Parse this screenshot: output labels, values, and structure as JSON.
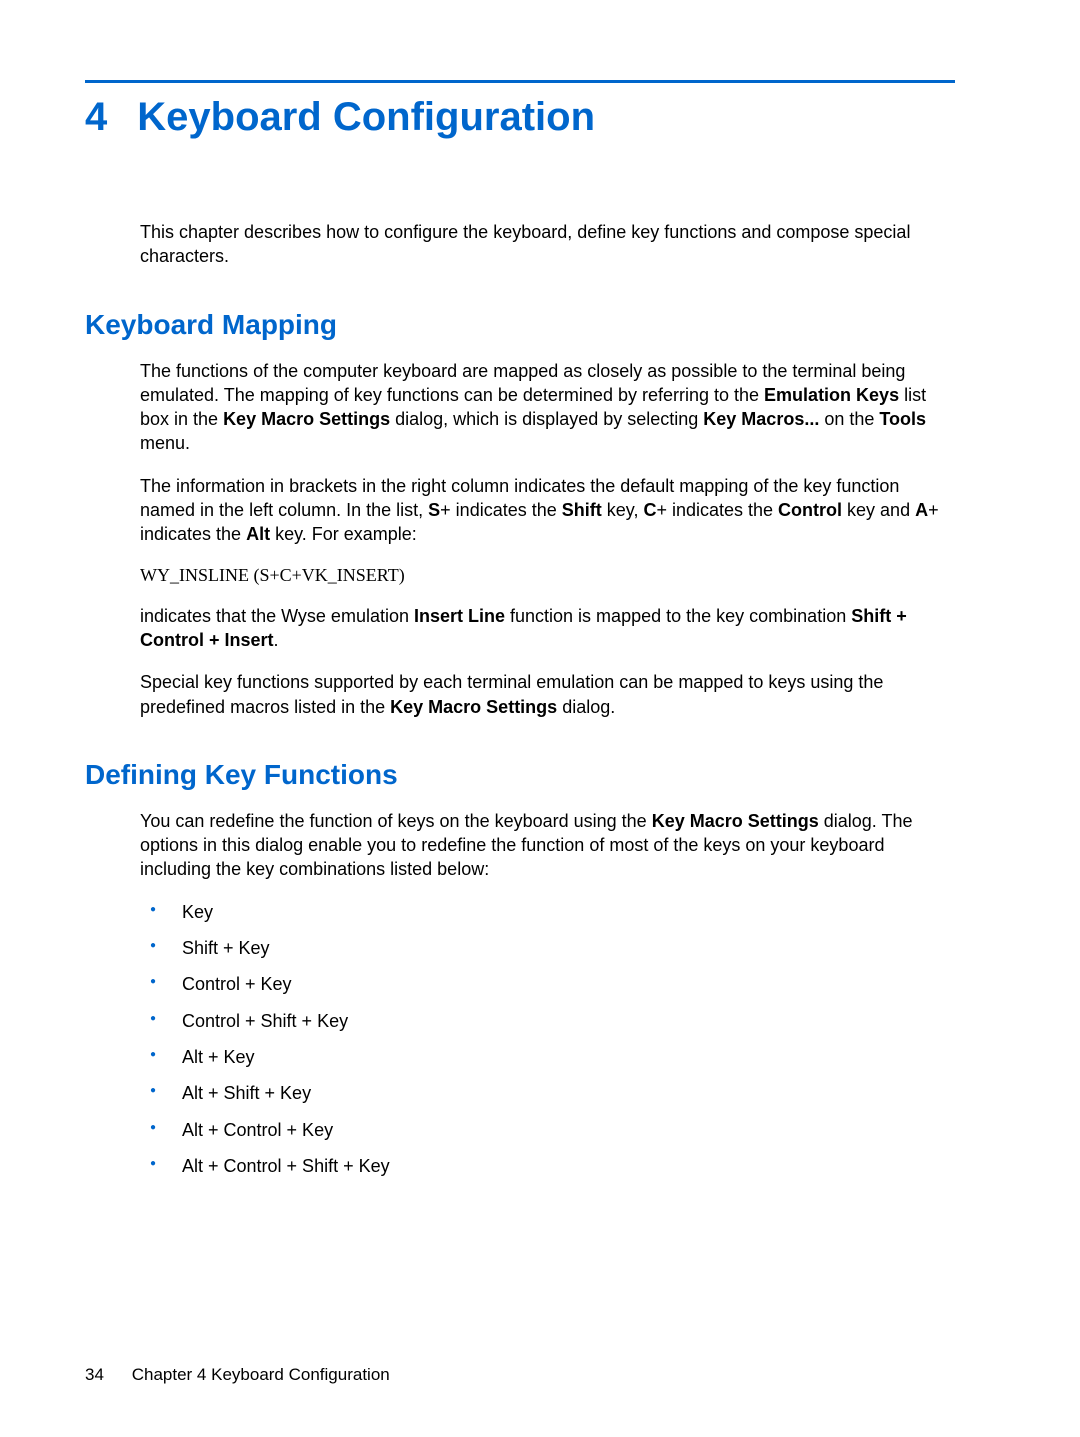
{
  "chapter": {
    "number": "4",
    "title": "Keyboard Configuration",
    "intro": "This chapter describes how to configure the keyboard, define key functions and compose special characters."
  },
  "sections": {
    "mapping": {
      "heading": "Keyboard Mapping",
      "p1_a": "The functions of the computer keyboard are mapped as closely as possible to the terminal being emulated. The mapping of key functions can be determined by referring to the ",
      "p1_b1": "Emulation Keys",
      "p1_c": " list box in the ",
      "p1_b2": "Key Macro Settings",
      "p1_d": " dialog, which is displayed by selecting ",
      "p1_b3": "Key Macros...",
      "p1_e": " on the ",
      "p1_b4": "Tools",
      "p1_f": " menu.",
      "p2_a": "The information in brackets in the right column indicates the default mapping of the key function named in the left column. In the list, ",
      "p2_b1": "S",
      "p2_c": "+ indicates the ",
      "p2_b2": "Shift",
      "p2_d": " key, ",
      "p2_b3": "C",
      "p2_e": "+ indicates the ",
      "p2_b4": "Control",
      "p2_f": " key and ",
      "p2_b5": "A",
      "p2_g": "+ indicates the ",
      "p2_b6": "Alt",
      "p2_h": " key. For example:",
      "code": "WY_INSLINE (S+C+VK_INSERT)",
      "p3_a": "indicates that the Wyse emulation ",
      "p3_b1": "Insert Line",
      "p3_c": " function is mapped to the key combination ",
      "p3_b2": "Shift + Control + Insert",
      "p3_d": ".",
      "p4_a": "Special key functions supported by each terminal emulation can be mapped to keys using the predefined macros listed in the ",
      "p4_b1": "Key Macro Settings",
      "p4_c": " dialog."
    },
    "defining": {
      "heading": "Defining Key Functions",
      "p1_a": "You can redefine the function of keys on the keyboard using the ",
      "p1_b1": "Key Macro Settings",
      "p1_c": " dialog. The options in this dialog enable you to redefine the function of most of the keys on your keyboard including the key combinations listed below:",
      "bullets": [
        "Key",
        "Shift + Key",
        "Control + Key",
        "Control + Shift + Key",
        "Alt + Key",
        "Alt + Shift + Key",
        "Alt + Control + Key",
        "Alt + Control + Shift + Key"
      ]
    }
  },
  "footer": {
    "page_number": "34",
    "chapter_label": "Chapter 4   Keyboard Configuration"
  }
}
